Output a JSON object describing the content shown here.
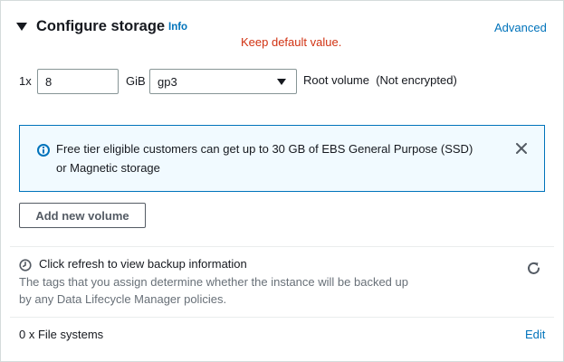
{
  "section": {
    "title": "Configure storage",
    "info_link": "Info",
    "advanced_link": "Advanced",
    "annotation": "Keep default value."
  },
  "volume": {
    "count_label": "1x",
    "size_value": "8",
    "unit": "GiB",
    "type_selected": "gp3",
    "description": "Root volume  (Not encrypted)"
  },
  "alert": {
    "icon": "info-circle-icon",
    "text": "Free tier eligible customers can get up to 30 GB of EBS General Purpose (SSD) or Magnetic storage"
  },
  "add_volume_button": "Add new volume",
  "backup": {
    "title": "Click refresh to view backup information",
    "description": "The tags that you assign determine whether the instance will be backed up by any Data Lifecycle Manager policies."
  },
  "file_systems": {
    "label": "0 x File systems",
    "edit_link": "Edit"
  },
  "colors": {
    "link": "#0073bb",
    "annotation": "#d13212",
    "alert_border": "#0073bb",
    "alert_background": "#f1faff"
  }
}
